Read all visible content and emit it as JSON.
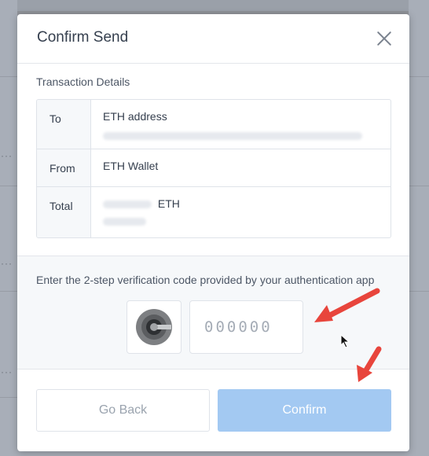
{
  "modal": {
    "title": "Confirm Send",
    "section_label": "Transaction Details",
    "details": [
      {
        "label": "To",
        "value": "ETH address"
      },
      {
        "label": "From",
        "value": "ETH Wallet"
      },
      {
        "label": "Total",
        "value": "ETH"
      }
    ],
    "verification": {
      "instruction": "Enter the 2-step verification code provided by your authentication app",
      "placeholder": "000000",
      "value": ""
    },
    "buttons": {
      "back": "Go Back",
      "confirm": "Confirm"
    }
  },
  "colors": {
    "confirm_button": "#a3c9f2",
    "annotation_arrow": "#e8453c",
    "title_text": "#353f4e"
  },
  "icons": {
    "close": "close-icon",
    "authenticator": "google-authenticator-icon"
  }
}
